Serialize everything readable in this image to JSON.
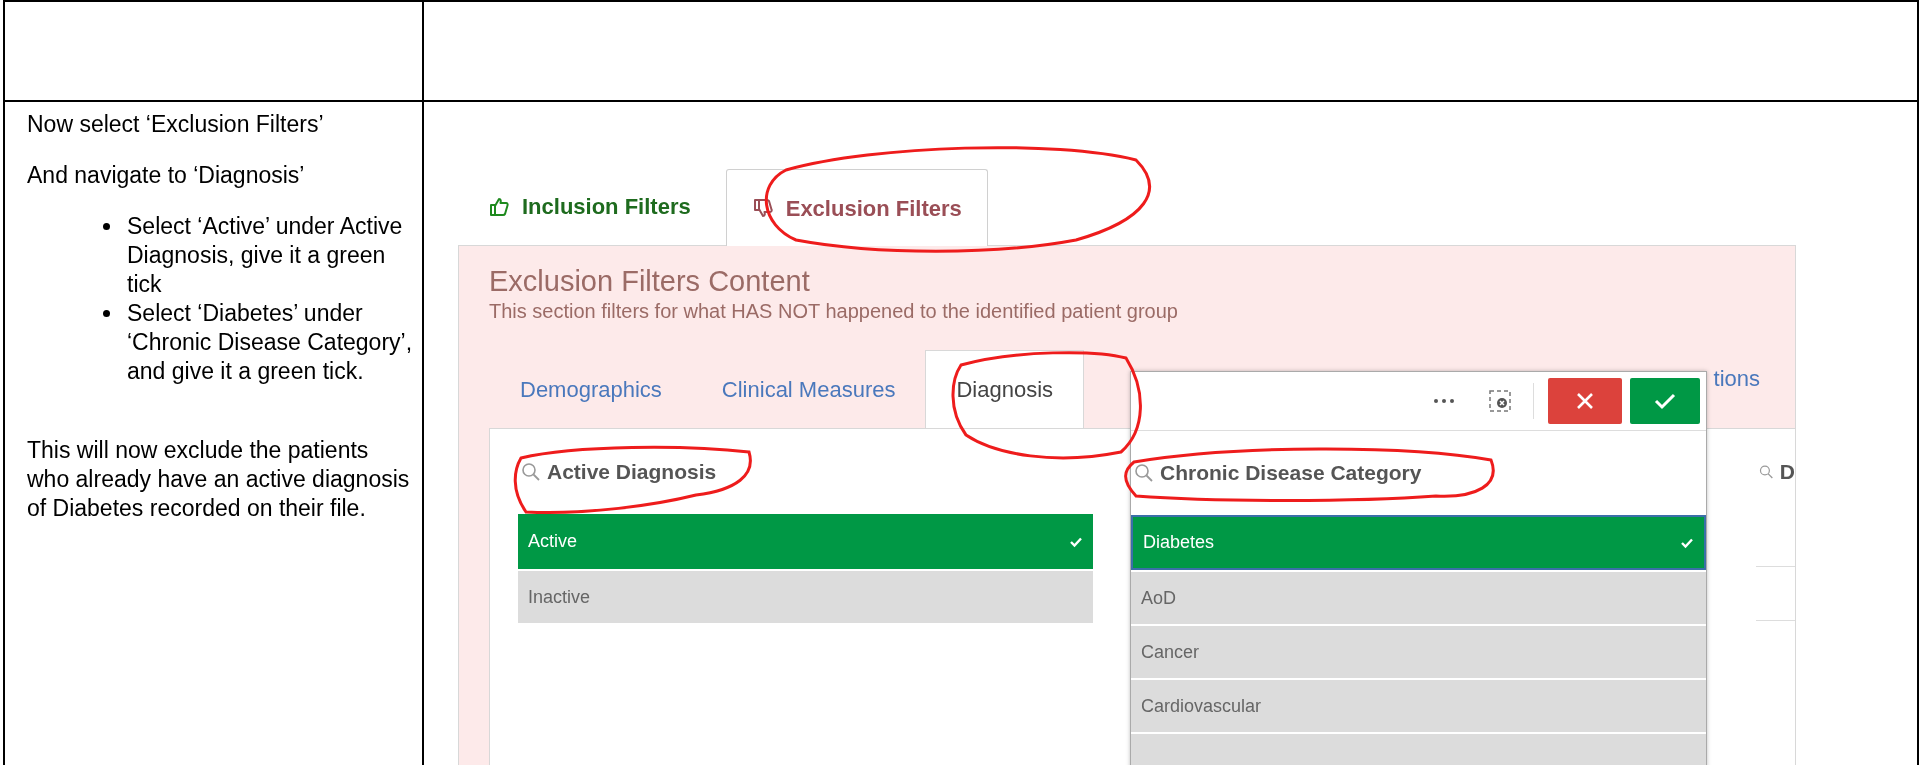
{
  "document": {
    "instructions": [
      {
        "kind": "paragraph",
        "text": "Now select ‘Exclusion Filters’"
      },
      {
        "kind": "paragraph",
        "text": "And navigate to ‘Diagnosis’"
      },
      {
        "kind": "bullets",
        "items": [
          "Select ‘Active’ under Active Diagnosis, give it a green tick",
          "Select ‘Diabetes’ under ‘Chronic Disease Category’, and give it a green tick."
        ]
      },
      {
        "kind": "paragraph",
        "text": "This will now exclude the patients who already have an active diagnosis of Diabetes recorded on their file."
      }
    ]
  },
  "screenshot": {
    "main_tabs": [
      {
        "kind": "inclusion",
        "label": "Inclusion Filters",
        "selected": false
      },
      {
        "kind": "exclusion",
        "label": "Exclusion Filters",
        "selected": true
      }
    ],
    "panel": {
      "title": "Exclusion Filters Content",
      "subtitle": "This section filters for what HAS NOT happened to the identified patient group"
    },
    "section_tabs": [
      {
        "label": "Demographics",
        "selected": false
      },
      {
        "label": "Clinical Measures",
        "selected": false
      },
      {
        "label": "Diagnosis",
        "selected": true
      },
      {
        "label": "tions",
        "selected": false
      }
    ],
    "filters": [
      {
        "kind": "list",
        "title": "Active Diagnosis",
        "values": [
          {
            "label": "Active",
            "selected": true
          },
          {
            "label": "Inactive",
            "selected": false
          }
        ]
      },
      {
        "kind": "popup",
        "title": "Chronic Disease Category",
        "values": [
          {
            "label": "Diabetes",
            "selected": true
          },
          {
            "label": "AoD",
            "selected": false
          },
          {
            "label": "Cancer",
            "selected": false
          },
          {
            "label": "Cardiovascular",
            "selected": false
          }
        ]
      },
      {
        "kind": "list",
        "title": "D"
      }
    ]
  }
}
